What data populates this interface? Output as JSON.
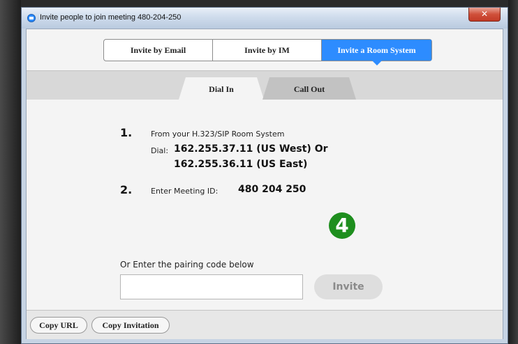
{
  "window": {
    "title": "Invite people to join meeting 480-204-250",
    "close_glyph": "✕"
  },
  "invite_tabs": {
    "email": "Invite by Email",
    "im": "Invite by IM",
    "room": "Invite a Room System",
    "active": "room",
    "accent_color": "#2d8cff"
  },
  "sub_tabs": {
    "dial_in": "Dial In",
    "call_out": "Call Out",
    "active": "dial_in"
  },
  "steps": {
    "step1_number": "1.",
    "step1_text": "From your H.323/SIP Room System",
    "dial_label": "Dial:",
    "dial_line1": "162.255.37.11 (US West) Or",
    "dial_line2": "162.255.36.11 (US East)",
    "step2_number": "2.",
    "step2_text": "Enter Meeting ID:",
    "meeting_id": "480 204 250"
  },
  "annotation_badge": {
    "label": "4",
    "color": "#1e8e1e"
  },
  "pairing": {
    "label": "Or Enter the pairing code below",
    "input_value": "",
    "input_placeholder": "",
    "invite_button": "Invite"
  },
  "footer": {
    "copy_url": "Copy URL",
    "copy_invitation": "Copy Invitation"
  }
}
